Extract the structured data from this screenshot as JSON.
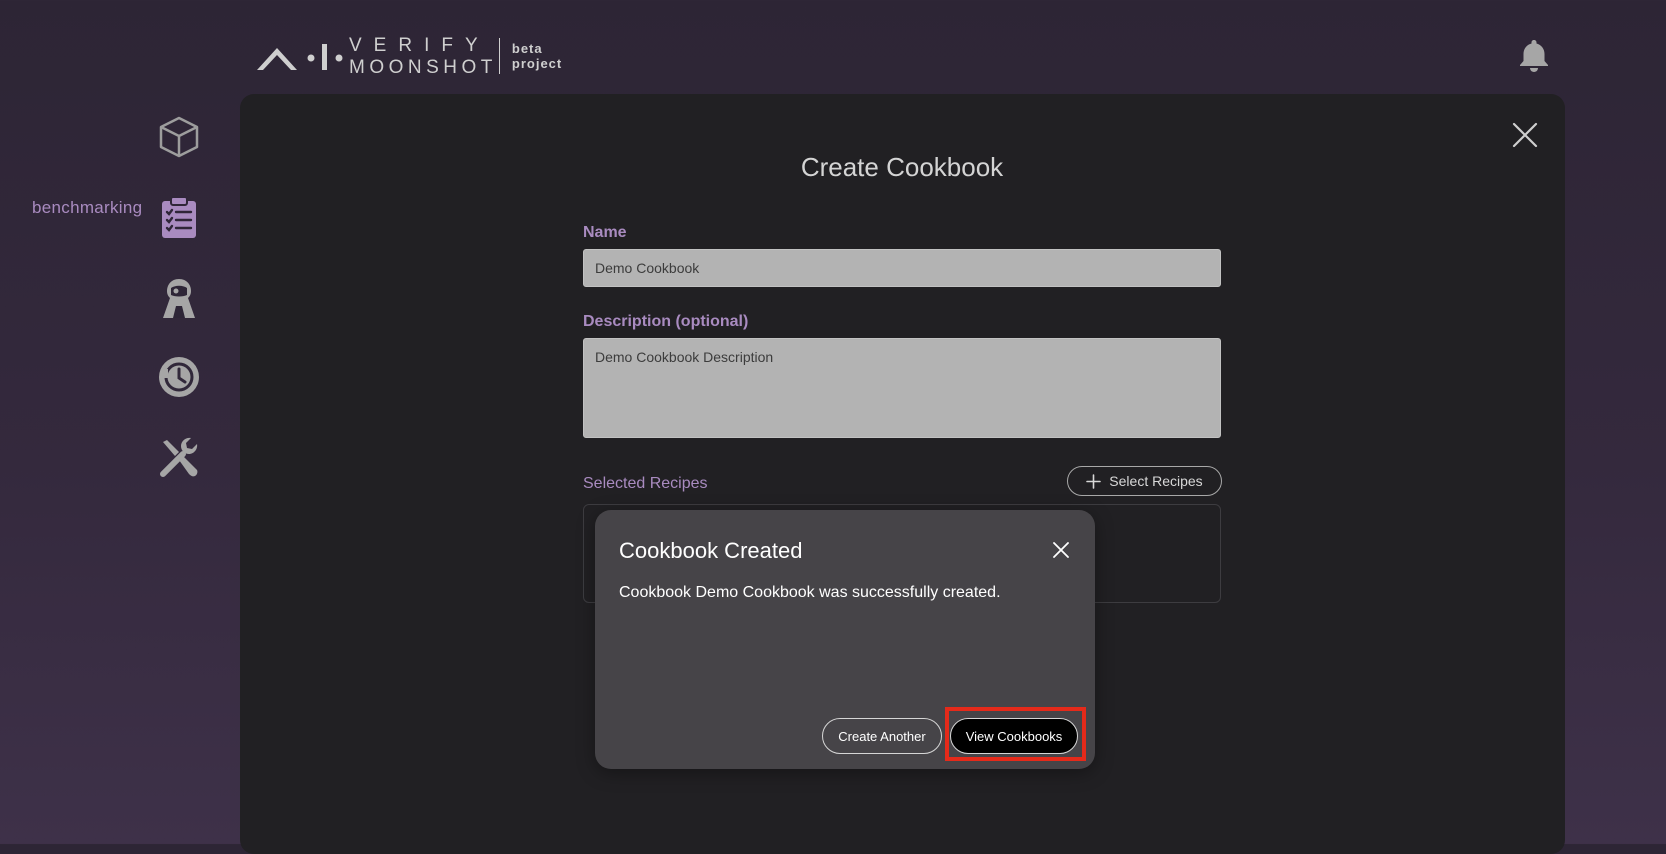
{
  "brand": {
    "line1": "VERIFY",
    "line2": "MOONSHOT",
    "tag1": "beta",
    "tag2": "project"
  },
  "sidebar": {
    "items": [
      {
        "icon": "cube-icon",
        "label": ""
      },
      {
        "icon": "clipboard-list-icon",
        "label": "benchmarking",
        "active": true
      },
      {
        "icon": "red-teaming-agent-icon",
        "label": ""
      },
      {
        "icon": "history-icon",
        "label": ""
      },
      {
        "icon": "tools-icon",
        "label": ""
      }
    ]
  },
  "form": {
    "title": "Create Cookbook",
    "name_label": "Name",
    "name_value": "Demo Cookbook",
    "description_label": "Description (optional)",
    "description_value": "Demo Cookbook Description",
    "selected_recipes_label": "Selected Recipes",
    "select_recipes_button": "Select Recipes"
  },
  "modal": {
    "title": "Cookbook Created",
    "message": "Cookbook Demo Cookbook was successfully created.",
    "create_another": "Create Another",
    "view_cookbooks": "View Cookbooks"
  },
  "colors": {
    "accent": "#a98bc0",
    "panel": "#212023",
    "modal": "#464448",
    "highlight": "#e52a1a"
  }
}
